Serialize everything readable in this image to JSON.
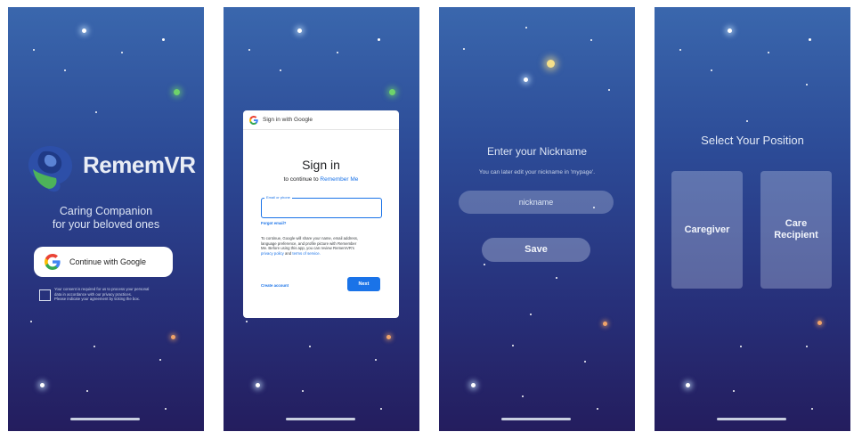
{
  "screens": {
    "login": {
      "logo_text": "RememVR",
      "tagline_line1": "Caring Companion",
      "tagline_line2": "for your beloved ones",
      "google_button": "Continue with Google",
      "consent_line1": "Your consent is required for us to process your personal",
      "consent_line2": "data in accordance with our privacy practices.",
      "consent_line3": "Please indicate your agreement by ticking the box."
    },
    "google_signin": {
      "header": "Sign in with Google",
      "title": "Sign in",
      "subtitle_prefix": "to continue to",
      "subtitle_app": "Remember Me",
      "field_label": "Email or phone",
      "forgot_link": "Forgot email?",
      "info_line1": "To continue, Google will share your name, email address,",
      "info_line2": "language preference, and profile picture with Remember",
      "info_line3": "Me. Before using this app, you can review RememVR's",
      "info_privacy": "privacy policy",
      "info_and": "and",
      "info_terms": "terms of service.",
      "create_account": "Create account",
      "next_button": "Next"
    },
    "nickname": {
      "title": "Enter your Nickname",
      "subtitle": "You can later edit your nickname in 'mypage'.",
      "placeholder": "nickname",
      "save_button": "Save"
    },
    "position": {
      "title": "Select Your Position",
      "option_caregiver": "Caregiver",
      "option_care_line1": "Care",
      "option_care_line2": "Recipient"
    }
  },
  "colors": {
    "background_top": "#3a67ad",
    "background_bottom": "#241d5e",
    "google_blue": "#1a73e8"
  }
}
